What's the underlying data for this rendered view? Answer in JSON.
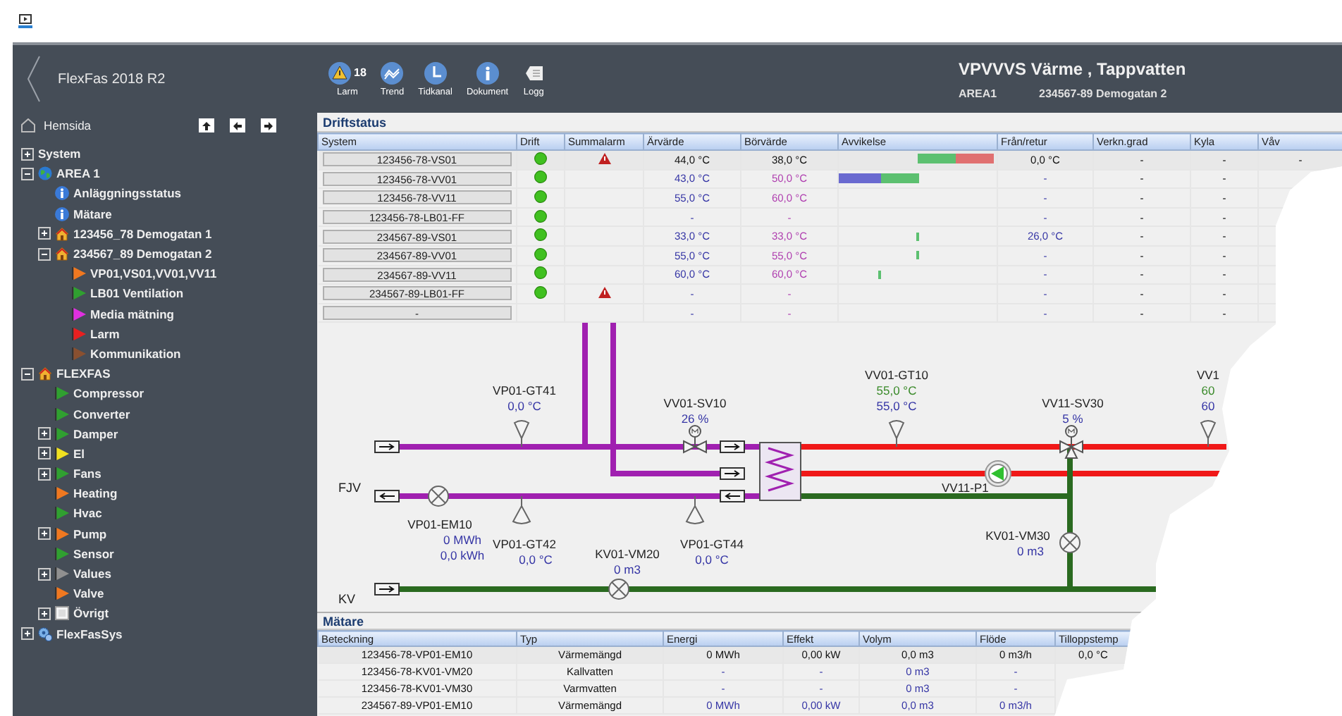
{
  "header": {
    "app_title": "FlexFas 2018 R2",
    "tools": [
      {
        "label": "Larm",
        "kind": "alarm",
        "count": "18"
      },
      {
        "label": "Trend",
        "kind": "trend"
      },
      {
        "label": "Tidkanal",
        "kind": "clock"
      },
      {
        "label": "Dokument",
        "kind": "info"
      },
      {
        "label": "Logg",
        "kind": "log"
      }
    ],
    "page_title": "VPVVVS Värme , Tappvatten",
    "area": "AREA1",
    "address": "234567-89 Demogatan 2"
  },
  "sidebar": {
    "home": "Hemsida",
    "tree": [
      {
        "label": "System",
        "expanded": false,
        "kind": "plain"
      },
      {
        "label": "AREA 1",
        "expanded": true,
        "kind": "globe",
        "children": [
          {
            "label": "Anläggningsstatus",
            "kind": "info"
          },
          {
            "label": "Mätare",
            "kind": "info"
          },
          {
            "label": "123456_78 Demogatan 1",
            "expanded": false,
            "kind": "house"
          },
          {
            "label": "234567_89 Demogatan 2",
            "expanded": true,
            "kind": "house",
            "children": [
              {
                "label": "VP01,VS01,VV01,VV11",
                "kind": "flag",
                "color": "#f07820"
              },
              {
                "label": "LB01 Ventilation",
                "kind": "flag",
                "color": "#30a030"
              },
              {
                "label": "Media mätning",
                "kind": "flag",
                "color": "#e030e0"
              },
              {
                "label": "Larm",
                "kind": "flag",
                "color": "#e82020"
              },
              {
                "label": "Kommunikation",
                "kind": "flag",
                "color": "#8a5030"
              }
            ]
          }
        ]
      },
      {
        "label": "FLEXFAS",
        "expanded": true,
        "kind": "house",
        "children": [
          {
            "label": "Compressor",
            "kind": "flag",
            "color": "#30a030"
          },
          {
            "label": "Converter",
            "kind": "flag",
            "color": "#30a030"
          },
          {
            "label": "Damper",
            "expanded": false,
            "kind": "flag",
            "color": "#30a030"
          },
          {
            "label": "El",
            "expanded": false,
            "kind": "flag",
            "color": "#f0e020"
          },
          {
            "label": "Fans",
            "expanded": false,
            "kind": "flag",
            "color": "#30a030"
          },
          {
            "label": "Heating",
            "kind": "flag",
            "color": "#f07820"
          },
          {
            "label": "Hvac",
            "kind": "flag",
            "color": "#30a030"
          },
          {
            "label": "Pump",
            "expanded": false,
            "kind": "flag",
            "color": "#f07820"
          },
          {
            "label": "Sensor",
            "kind": "flag",
            "color": "#30a030"
          },
          {
            "label": "Values",
            "expanded": false,
            "kind": "flag",
            "color": "#909090"
          },
          {
            "label": "Valve",
            "kind": "flag",
            "color": "#f07820"
          },
          {
            "label": "Övrigt",
            "expanded": false,
            "kind": "box"
          }
        ]
      },
      {
        "label": "FlexFasSys",
        "expanded": false,
        "kind": "gears"
      }
    ]
  },
  "status": {
    "title": "Driftstatus",
    "columns": [
      "System",
      "Drift",
      "Summalarm",
      "Ärvärde",
      "Börvärde",
      "Avvikelse",
      "Från/retur",
      "Verkn.grad",
      "Kyla",
      "Våv"
    ],
    "rows": [
      {
        "system": "123456-78-VS01",
        "running": true,
        "alarm": true,
        "actual": "44,0 °C",
        "setpoint": "38,0 °C",
        "deviation": {
          "kind": "above"
        },
        "return": "0,0 °C",
        "efficiency": "-",
        "cooling": "-",
        "vav": "-",
        "selected": true
      },
      {
        "system": "123456-78-VV01",
        "running": true,
        "alarm": false,
        "actual": "43,0 °C",
        "setpoint": "50,0 °C",
        "deviation": {
          "kind": "below"
        },
        "return": "-",
        "efficiency": "-",
        "cooling": "-",
        "selected": false
      },
      {
        "system": "123456-78-VV11",
        "running": true,
        "alarm": false,
        "actual": "55,0 °C",
        "setpoint": "60,0 °C",
        "return": "-",
        "efficiency": "-",
        "cooling": "-",
        "selected": false
      },
      {
        "system": "123456-78-LB01-FF",
        "running": true,
        "alarm": false,
        "actual": "-",
        "setpoint": "-",
        "return": "-",
        "efficiency": "-",
        "cooling": "-",
        "selected": false
      },
      {
        "system": "234567-89-VS01",
        "running": true,
        "alarm": false,
        "actual": "33,0 °C",
        "setpoint": "33,0 °C",
        "deviation": {
          "kind": "tick"
        },
        "return": "26,0 °C",
        "efficiency": "-",
        "cooling": "-",
        "selected": false
      },
      {
        "system": "234567-89-VV01",
        "running": true,
        "alarm": false,
        "actual": "55,0 °C",
        "setpoint": "55,0 °C",
        "deviation": {
          "kind": "tick"
        },
        "return": "-",
        "efficiency": "-",
        "cooling": "-",
        "selected": false
      },
      {
        "system": "234567-89-VV11",
        "running": true,
        "alarm": false,
        "actual": "60,0 °C",
        "setpoint": "60,0 °C",
        "deviation": {
          "kind": "tick_low"
        },
        "return": "-",
        "efficiency": "-",
        "cooling": "-",
        "selected": false
      },
      {
        "system": "234567-89-LB01-FF",
        "running": true,
        "alarm": true,
        "actual": "-",
        "setpoint": "-",
        "return": "-",
        "efficiency": "-",
        "cooling": "-",
        "selected": false
      },
      {
        "system": "-",
        "running": false,
        "alarm": false,
        "actual": "-",
        "setpoint": "-",
        "return": "-",
        "efficiency": "-",
        "cooling": "-",
        "selected": false
      }
    ]
  },
  "diagram": {
    "side_labels": [
      "FJV",
      "KV"
    ],
    "points": [
      {
        "tag": "VP01-GT41",
        "kind": "sensor_up",
        "readings": [
          {
            "text": "0,0 °C",
            "kind": "actual"
          }
        ]
      },
      {
        "tag": "VV01-SV10",
        "kind": "valve",
        "readings": [
          {
            "text": "26 %",
            "kind": "actual"
          }
        ]
      },
      {
        "tag": "VV01-GT10",
        "kind": "sensor_up",
        "readings": [
          {
            "text": "55,0 °C",
            "kind": "setpoint"
          },
          {
            "text": "55,0 °C",
            "kind": "actual"
          }
        ]
      },
      {
        "tag": "VV11-SV30",
        "kind": "valve3",
        "readings": [
          {
            "text": "5 %",
            "kind": "actual"
          }
        ]
      },
      {
        "tag": "VV1",
        "kind": "sensor_up",
        "readings": [
          {
            "text": "60",
            "kind": "setpoint"
          },
          {
            "text": "60",
            "kind": "actual"
          }
        ]
      },
      {
        "tag": "VV11-P1",
        "kind": "pump"
      },
      {
        "tag": "VP01-EM10",
        "kind": "meter",
        "readings": [
          {
            "text": "0 MWh",
            "kind": "actual"
          },
          {
            "text": "0,0 kWh",
            "kind": "actual"
          }
        ]
      },
      {
        "tag": "VP01-GT42",
        "kind": "sensor_down",
        "readings": [
          {
            "text": "0,0 °C",
            "kind": "actual"
          }
        ]
      },
      {
        "tag": "KV01-VM20",
        "kind": "meter",
        "readings": [
          {
            "text": "0 m3",
            "kind": "actual"
          }
        ]
      },
      {
        "tag": "VP01-GT44",
        "kind": "sensor_down",
        "readings": [
          {
            "text": "0,0 °C",
            "kind": "actual"
          }
        ]
      },
      {
        "tag": "KV01-VM30",
        "kind": "meter",
        "readings": [
          {
            "text": "0 m3",
            "kind": "actual"
          }
        ]
      }
    ]
  },
  "meters": {
    "title": "Mätare",
    "columns": [
      "Beteckning",
      "Typ",
      "Energi",
      "Effekt",
      "Volym",
      "Flöde",
      "Tilloppstemp"
    ],
    "rows": [
      {
        "cells": [
          "123456-78-VP01-EM10",
          "Värmemängd",
          "0 MWh",
          "0,00 kW",
          "0,0 m3",
          "0 m3/h",
          "0,0 °C"
        ],
        "selected": true
      },
      {
        "cells": [
          "123456-78-KV01-VM20",
          "Kallvatten",
          "-",
          "-",
          "0 m3",
          "-"
        ],
        "selected": false
      },
      {
        "cells": [
          "123456-78-KV01-VM30",
          "Varmvatten",
          "-",
          "-",
          "0 m3",
          "-"
        ],
        "selected": false
      },
      {
        "cells": [
          "234567-89-VP01-EM10",
          "Värmemängd",
          "0 MWh",
          "0,00 kW",
          "0,0 m3",
          "0 m3/h"
        ],
        "selected": false
      }
    ]
  }
}
